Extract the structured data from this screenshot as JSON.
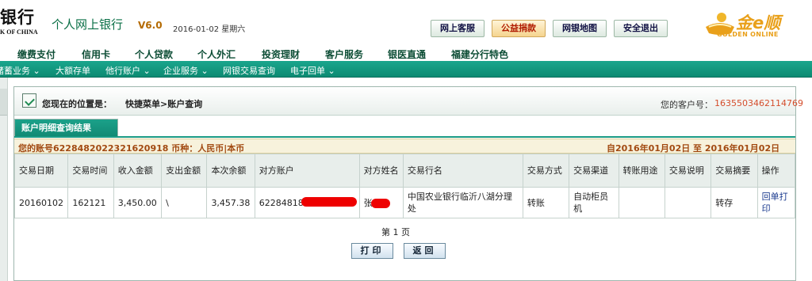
{
  "header": {
    "bank_name": "银行",
    "bank_en": "K OF CHINA",
    "product_title": "个人网上银行",
    "version": "V6.0",
    "date": "2016-01-02 星期六",
    "buttons": [
      "网上客服",
      "公益捐款",
      "网银地图",
      "安全退出"
    ],
    "logo_cn": "金e顺",
    "logo_en": "GOLDEN ONLINE"
  },
  "main_nav": [
    "缴费支付",
    "信用卡",
    "个人贷款",
    "个人外汇",
    "投资理财",
    "客户服务",
    "银医直通",
    "福建分行特色"
  ],
  "sub_nav": [
    "储蓄业务 ⌄",
    "大额存单",
    "他行账户 ⌄",
    "企业服务 ⌄",
    "网银交易查询",
    "电子回单 ⌄"
  ],
  "location": {
    "label": "您现在的位置是：",
    "path": "快捷菜单>账户查询",
    "customer_label": "您的客户号：",
    "customer_no": "1635503462114769"
  },
  "tab_title": "账户明细查询结果",
  "account_bar": {
    "left": "您的账号6228482022321620918 币种：人民币|本币",
    "right": "自2016年01月02日  至  2016年01月02日"
  },
  "table": {
    "headers": [
      "交易日期",
      "交易时间",
      "收入金额",
      "支出金额",
      "本次余额",
      "对方账户",
      "对方姓名",
      "交易行名",
      "交易方式",
      "交易渠道",
      "转账用途",
      "交易说明",
      "交易摘要",
      "操作"
    ],
    "rows": [
      {
        "date": "20160102",
        "time": "162121",
        "income": "3,450.00",
        "expense": "\\",
        "balance": "3,457.38",
        "counter_account": "622848185",
        "counter_name": "张",
        "bank_name": "中国农业银行临沂八湖分理处",
        "method": "转账",
        "channel": "自动柜员机",
        "purpose": "",
        "note": "",
        "summary": "转存",
        "action": "回单打印"
      }
    ]
  },
  "page_info": "第 1 页",
  "buttons": {
    "print": "打印",
    "back": "返回"
  },
  "colors": {
    "accent_green": "#0d8a72",
    "highlight_red": "#d44d2c",
    "account_brown": "#a24a12"
  }
}
